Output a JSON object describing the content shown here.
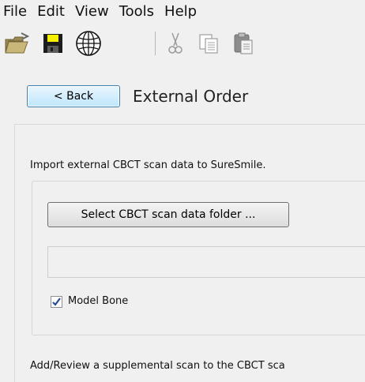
{
  "menu": [
    "File",
    "Edit",
    "View",
    "Tools",
    "Help"
  ],
  "toolbar": {
    "icons": [
      "open-folder-icon",
      "save-icon",
      "globe-icon",
      "cut-icon",
      "copy-icon",
      "paste-icon"
    ]
  },
  "header": {
    "back_label": "< Back",
    "title": "External Order"
  },
  "main": {
    "intro": "Import external CBCT scan data to SureSmile.",
    "select_button": "Select CBCT scan data folder ...",
    "folder_path": "",
    "model_bone": {
      "label": "Model Bone",
      "checked": true
    },
    "footer": "Add/Review a supplemental scan to the CBCT sca"
  }
}
